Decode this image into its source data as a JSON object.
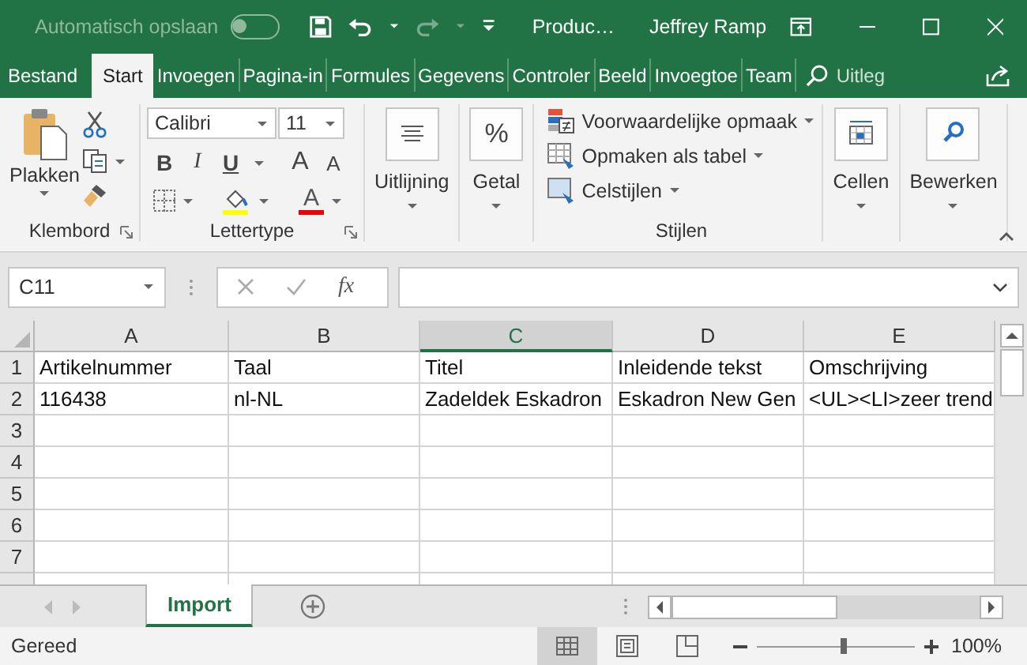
{
  "title_bar": {
    "autosave_label": "Automatisch opslaan",
    "autosave_on": false,
    "quick_access": [
      {
        "kind": "save",
        "disabled": false
      },
      {
        "kind": "undo",
        "disabled": false
      },
      {
        "kind": "redo",
        "disabled": true
      }
    ],
    "document": "Produc…",
    "user": "Jeffrey Ramp"
  },
  "tabs": [
    {
      "label": "Bestand",
      "selected": false
    },
    {
      "label": "Start",
      "selected": true
    },
    {
      "label": "Invoegen",
      "selected": false
    },
    {
      "label": "Pagina-in",
      "selected": false
    },
    {
      "label": "Formules",
      "selected": false
    },
    {
      "label": "Gegevens",
      "selected": false
    },
    {
      "label": "Controler",
      "selected": false
    },
    {
      "label": "Beeld",
      "selected": false
    },
    {
      "label": "Invoegtoe",
      "selected": false
    },
    {
      "label": "Team",
      "selected": false
    }
  ],
  "tell_me": "Uitleg",
  "ribbon": {
    "groups": [
      {
        "kind": "clipboard",
        "label": "Klembord",
        "paste": "Plakken"
      },
      {
        "kind": "font",
        "label": "Lettertype",
        "font": "Calibri",
        "size": "11",
        "bold": "B",
        "italic": "I",
        "underline": "U",
        "grow": "A",
        "shrink": "A",
        "font_color": "A"
      },
      {
        "kind": "alignment",
        "button": "Uitlijning"
      },
      {
        "kind": "number",
        "button": "Getal",
        "glyph": "%"
      },
      {
        "kind": "styles",
        "label": "Stijlen",
        "items": [
          "Voorwaardelijke opmaak",
          "Opmaken als tabel",
          "Celstijlen"
        ]
      },
      {
        "kind": "cells",
        "button": "Cellen"
      },
      {
        "kind": "editing",
        "button": "Bewerken"
      }
    ]
  },
  "formula_bar": {
    "name_box": "C11",
    "fx": "fx"
  },
  "sheet": {
    "columns": [
      {
        "label": "A",
        "selected": false
      },
      {
        "label": "B",
        "selected": false
      },
      {
        "label": "C",
        "selected": true
      },
      {
        "label": "D",
        "selected": false
      },
      {
        "label": "E",
        "selected": false
      }
    ],
    "rows": [
      {
        "header": "1",
        "cells": [
          "Artikelnummer",
          "Taal",
          "Titel",
          "Inleidende tekst",
          "Omschrijving"
        ]
      },
      {
        "header": "2",
        "cells": [
          "116438",
          "nl-NL",
          "Zadeldek Eskadron",
          "Eskadron New Gen",
          "<UL><LI>zeer trend"
        ]
      },
      {
        "header": "3"
      },
      {
        "header": "4"
      },
      {
        "header": "5"
      },
      {
        "header": "6"
      },
      {
        "header": "7"
      }
    ]
  },
  "sheet_tabs": [
    {
      "label": "Import",
      "selected": true
    }
  ],
  "status_bar": {
    "status": "Gereed",
    "views": [
      {
        "kind": "normal",
        "selected": true
      },
      {
        "kind": "page_layout",
        "selected": false
      },
      {
        "kind": "page_break",
        "selected": false
      }
    ],
    "zoom": {
      "level": 0.55,
      "reading": "100%"
    }
  }
}
